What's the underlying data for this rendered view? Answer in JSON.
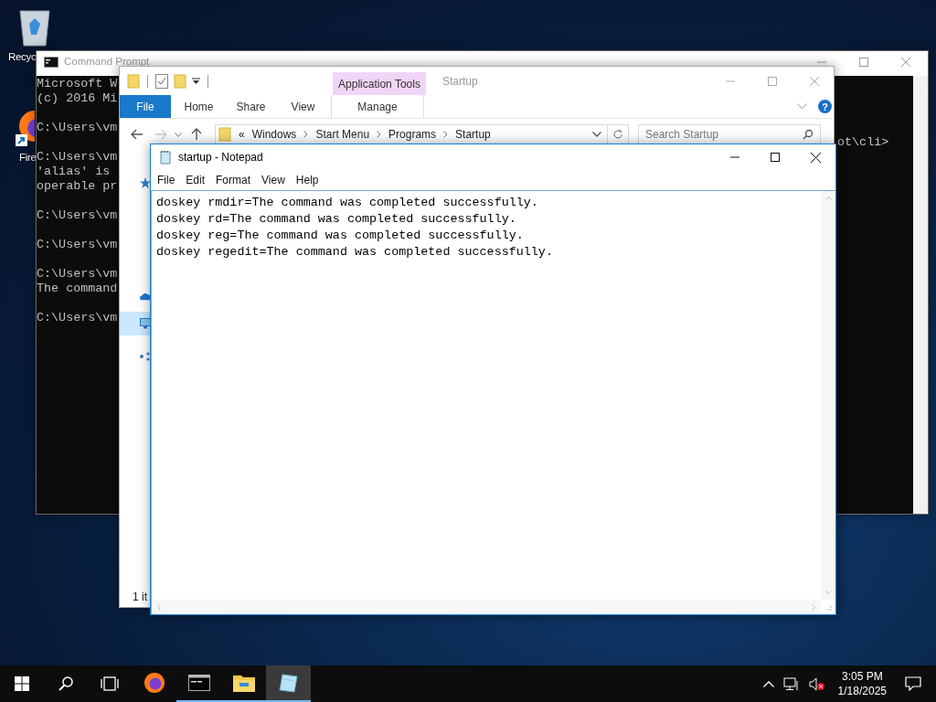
{
  "desktop_icons": [
    {
      "kind": "recycle-bin",
      "label": "Recyc"
    },
    {
      "kind": "firefox",
      "label": "Fire"
    }
  ],
  "cmd_window": {
    "title": "Command Prompt",
    "active": false,
    "lines": [
      {
        "kind": "text",
        "text": "Microsoft W"
      },
      {
        "kind": "text",
        "text": "(c) 2016 Mi"
      },
      {
        "kind": "blank"
      },
      {
        "kind": "text",
        "text": "C:\\Users\\vm"
      },
      {
        "kind": "tail",
        "text": "ot\\cli>"
      },
      {
        "kind": "text",
        "text": "C:\\Users\\vm"
      },
      {
        "kind": "text",
        "text": "'alias' is"
      },
      {
        "kind": "text",
        "text": "operable pr"
      },
      {
        "kind": "blank"
      },
      {
        "kind": "text",
        "text": "C:\\Users\\vm"
      },
      {
        "kind": "blank"
      },
      {
        "kind": "text",
        "text": "C:\\Users\\vm"
      },
      {
        "kind": "blank"
      },
      {
        "kind": "text",
        "text": "C:\\Users\\vm"
      },
      {
        "kind": "text",
        "text": "The command"
      },
      {
        "kind": "blank"
      },
      {
        "kind": "text",
        "text": "C:\\Users\\vm"
      }
    ]
  },
  "explorer_window": {
    "title": "Startup",
    "active": false,
    "contextual_group": "Application Tools",
    "ribbon_tabs": [
      {
        "kind": "file",
        "label": "File"
      },
      {
        "kind": "tab",
        "label": "Home"
      },
      {
        "kind": "tab",
        "label": "Share"
      },
      {
        "kind": "tab",
        "label": "View"
      },
      {
        "kind": "contextual",
        "label": "Manage"
      }
    ],
    "help": "?",
    "address": {
      "overflow": "«",
      "crumbs": [
        "Windows",
        "Start Menu",
        "Programs",
        "Startup"
      ]
    },
    "search": {
      "placeholder": "Search Startup"
    },
    "nav_items": [
      {
        "kind": "quick-access",
        "selected": false
      },
      {
        "kind": "onedrive",
        "selected": false
      },
      {
        "kind": "this-pc",
        "selected": true
      },
      {
        "kind": "network",
        "selected": false
      }
    ],
    "status": "1 it"
  },
  "notepad_window": {
    "title": "startup - Notepad",
    "active": true,
    "menu": [
      "File",
      "Edit",
      "Format",
      "View",
      "Help"
    ],
    "lines": [
      "doskey rmdir=The command was completed successfully.",
      "doskey rd=The command was completed successfully.",
      "doskey reg=The command was completed successfully.",
      "doskey regedit=The command was completed successfully."
    ]
  },
  "taskbar": {
    "apps": [
      {
        "kind": "firefox",
        "running": false,
        "active": false
      },
      {
        "kind": "cmd",
        "running": true,
        "active": false
      },
      {
        "kind": "explorer",
        "running": true,
        "active": false
      },
      {
        "kind": "notepad",
        "running": true,
        "active": true
      }
    ],
    "time": "3:05 PM",
    "date": "1/18/2025"
  }
}
